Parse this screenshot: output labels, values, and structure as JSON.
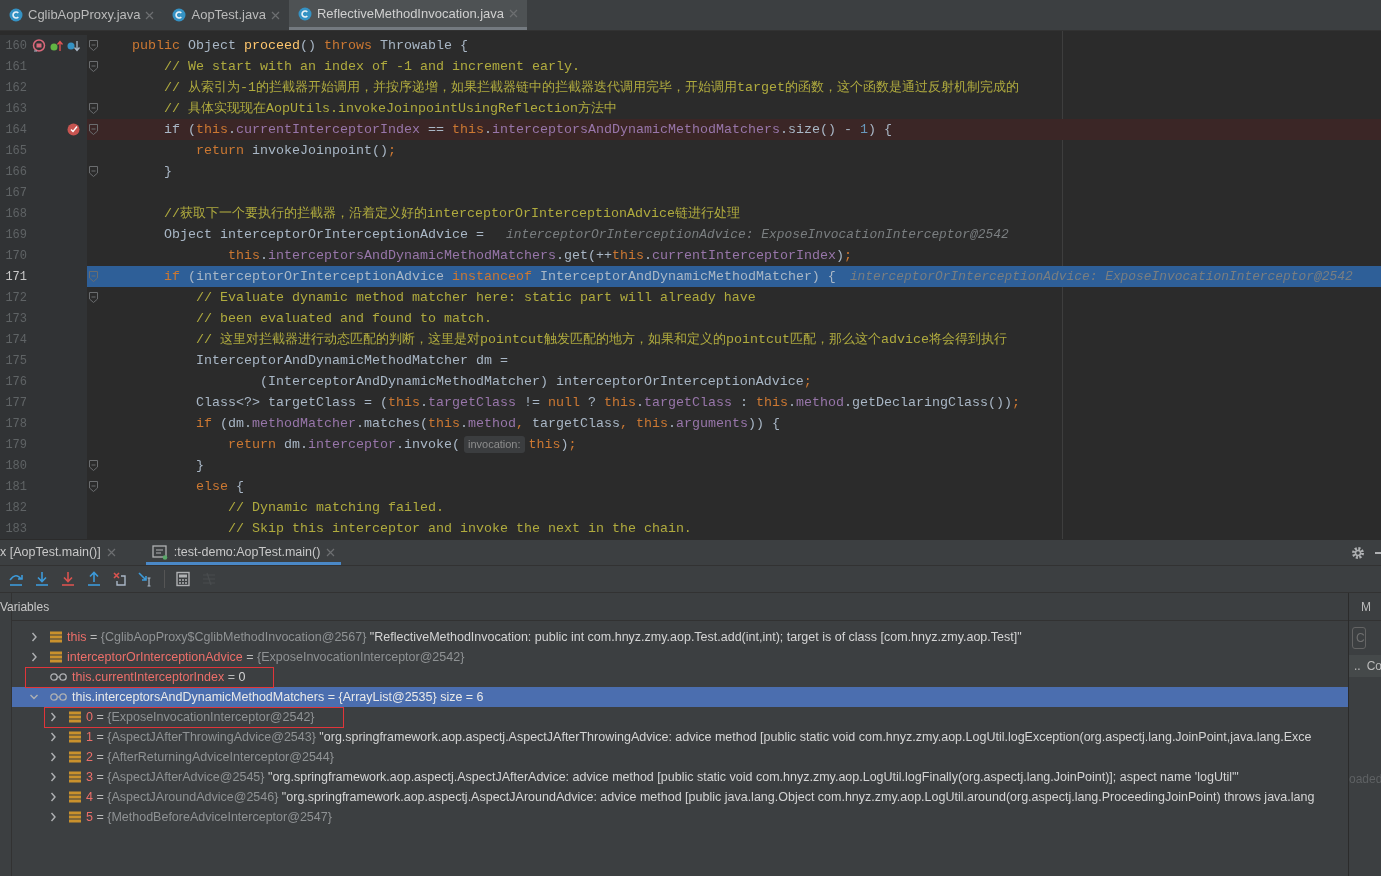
{
  "editor_tabs": [
    {
      "label": "CglibAopProxy.java",
      "selected": false
    },
    {
      "label": "AopTest.java",
      "selected": false
    },
    {
      "label": "ReflectiveMethodInvocation.java",
      "selected": true
    }
  ],
  "code_lines": [
    {
      "number": "160",
      "current": false,
      "fold": true,
      "gutter_icons": [
        {
          "kind": "method_breakpoint"
        },
        {
          "kind": "overrides"
        },
        {
          "kind": "overridden"
        }
      ],
      "tokens": [
        {
          "kind": "keyword",
          "text": "public"
        },
        {
          "kind": "plain",
          "text": " Object "
        },
        {
          "kind": "method",
          "text": "proceed"
        },
        {
          "kind": "plain",
          "text": "() "
        },
        {
          "kind": "keyword",
          "text": "throws"
        },
        {
          "kind": "plain",
          "text": " Throwable {"
        }
      ]
    },
    {
      "number": "161",
      "current": false,
      "fold": true,
      "tokens": [
        {
          "kind": "comment",
          "text": "    // We start with an index of -1 and increment early."
        }
      ]
    },
    {
      "number": "162",
      "current": false,
      "fold": false,
      "tokens": [
        {
          "kind": "comment",
          "text": "    // 从索引为-1的拦截器开始调用，并按序递增，如果拦截器链中的拦截器迭代调用完毕，开始调用target的函数，这个函数是通过反射机制完成的"
        }
      ]
    },
    {
      "number": "163",
      "current": false,
      "fold": true,
      "tokens": [
        {
          "kind": "comment",
          "text": "    // 具体实现现在AopUtils.invokeJoinpointUsingReflection方法中"
        }
      ]
    },
    {
      "number": "164",
      "current": false,
      "fold": true,
      "gutter_icons": [
        {
          "kind": "breakpoint"
        }
      ],
      "tokens": [
        {
          "kind": "plain",
          "text": "    if ("
        },
        {
          "kind": "keyword",
          "text": "this"
        },
        {
          "kind": "plain",
          "text": "."
        },
        {
          "kind": "field",
          "text": "currentInterceptorIndex"
        },
        {
          "kind": "plain",
          "text": " == "
        },
        {
          "kind": "keyword",
          "text": "this"
        },
        {
          "kind": "plain",
          "text": "."
        },
        {
          "kind": "field",
          "text": "interceptorsAndDynamicMethodMatchers"
        },
        {
          "kind": "plain",
          "text": ".size() - "
        },
        {
          "kind": "number",
          "text": "1"
        },
        {
          "kind": "plain",
          "text": ") {"
        }
      ]
    },
    {
      "number": "165",
      "current": false,
      "fold": false,
      "tokens": [
        {
          "kind": "keyword",
          "text": "        return"
        },
        {
          "kind": "plain",
          "text": " invokeJoinpoint()"
        },
        {
          "kind": "keyword",
          "text": ";"
        }
      ]
    },
    {
      "number": "166",
      "current": false,
      "fold": true,
      "tokens": [
        {
          "kind": "plain",
          "text": "    }"
        }
      ]
    },
    {
      "number": "167",
      "current": false,
      "fold": false
    },
    {
      "number": "168",
      "current": false,
      "fold": false,
      "tokens": [
        {
          "kind": "comment",
          "text": "    //获取下一个要执行的拦截器，沿着定义好的interceptorOrInterceptionAdvice链进行处理"
        }
      ]
    },
    {
      "number": "169",
      "current": false,
      "fold": false,
      "tokens": [
        {
          "kind": "plain",
          "text": "    Object interceptorOrInterceptionAdvice = "
        },
        {
          "kind": "hint",
          "text": "interceptorOrInterceptionAdvice: ExposeInvocationInterceptor@2542"
        }
      ]
    },
    {
      "number": "170",
      "current": false,
      "fold": false,
      "tokens": [
        {
          "kind": "keyword",
          "text": "            this"
        },
        {
          "kind": "plain",
          "text": "."
        },
        {
          "kind": "field",
          "text": "interceptorsAndDynamicMethodMatchers"
        },
        {
          "kind": "plain",
          "text": ".get(++"
        },
        {
          "kind": "keyword",
          "text": "this"
        },
        {
          "kind": "plain",
          "text": "."
        },
        {
          "kind": "field",
          "text": "currentInterceptorIndex"
        },
        {
          "kind": "plain",
          "text": ")"
        },
        {
          "kind": "keyword",
          "text": ";"
        }
      ]
    },
    {
      "number": "171",
      "current": true,
      "fold": true,
      "tokens": [
        {
          "kind": "keyword",
          "text": "    if"
        },
        {
          "kind": "plain",
          "text": " (interceptorOrInterceptionAdvice "
        },
        {
          "kind": "keyword",
          "text": "instanceof"
        },
        {
          "kind": "plain",
          "text": " InterceptorAndDynamicMethodMatcher) {"
        },
        {
          "kind": "hint",
          "text": "interceptorOrInterceptionAdvice: ExposeInvocationInterceptor@2542"
        }
      ]
    },
    {
      "number": "172",
      "current": false,
      "fold": true,
      "tokens": [
        {
          "kind": "comment",
          "text": "        // Evaluate dynamic method matcher here: static part will already have"
        }
      ]
    },
    {
      "number": "173",
      "current": false,
      "fold": false,
      "tokens": [
        {
          "kind": "comment",
          "text": "        // been evaluated and found to match."
        }
      ]
    },
    {
      "number": "174",
      "current": false,
      "fold": false,
      "tokens": [
        {
          "kind": "comment",
          "text": "        // 这里对拦截器进行动态匹配的判断，这里是对pointcut触发匹配的地方，如果和定义的pointcut匹配，那么这个advice将会得到执行"
        }
      ]
    },
    {
      "number": "175",
      "current": false,
      "fold": false,
      "tokens": [
        {
          "kind": "plain",
          "text": "        InterceptorAndDynamicMethodMatcher dm ="
        }
      ]
    },
    {
      "number": "176",
      "current": false,
      "fold": false,
      "tokens": [
        {
          "kind": "plain",
          "text": "                (InterceptorAndDynamicMethodMatcher) interceptorOrInterceptionAdvice"
        },
        {
          "kind": "keyword",
          "text": ";"
        }
      ]
    },
    {
      "number": "177",
      "current": false,
      "fold": false,
      "tokens": [
        {
          "kind": "plain",
          "text": "        Class<?> targetClass = ("
        },
        {
          "kind": "keyword",
          "text": "this"
        },
        {
          "kind": "plain",
          "text": "."
        },
        {
          "kind": "field",
          "text": "targetClass"
        },
        {
          "kind": "plain",
          "text": " != "
        },
        {
          "kind": "keyword",
          "text": "null"
        },
        {
          "kind": "plain",
          "text": " ? "
        },
        {
          "kind": "keyword",
          "text": "this"
        },
        {
          "kind": "plain",
          "text": "."
        },
        {
          "kind": "field",
          "text": "targetClass"
        },
        {
          "kind": "plain",
          "text": " : "
        },
        {
          "kind": "keyword",
          "text": "this"
        },
        {
          "kind": "plain",
          "text": "."
        },
        {
          "kind": "field",
          "text": "method"
        },
        {
          "kind": "plain",
          "text": ".getDeclaringClass())"
        },
        {
          "kind": "keyword",
          "text": ";"
        }
      ]
    },
    {
      "number": "178",
      "current": false,
      "fold": false,
      "tokens": [
        {
          "kind": "keyword",
          "text": "        if"
        },
        {
          "kind": "plain",
          "text": " (dm."
        },
        {
          "kind": "field",
          "text": "methodMatcher"
        },
        {
          "kind": "plain",
          "text": ".matches("
        },
        {
          "kind": "keyword",
          "text": "this"
        },
        {
          "kind": "plain",
          "text": "."
        },
        {
          "kind": "field",
          "text": "method"
        },
        {
          "kind": "keyword",
          "text": ","
        },
        {
          "kind": "plain",
          "text": " targetClass"
        },
        {
          "kind": "keyword",
          "text": ", "
        },
        {
          "kind": "keyword",
          "text": "this"
        },
        {
          "kind": "plain",
          "text": "."
        },
        {
          "kind": "field",
          "text": "arguments"
        },
        {
          "kind": "plain",
          "text": ")) {"
        }
      ]
    },
    {
      "number": "179",
      "current": false,
      "fold": false,
      "tokens": [
        {
          "kind": "keyword",
          "text": "            return"
        },
        {
          "kind": "plain",
          "text": " dm."
        },
        {
          "kind": "field",
          "text": "interceptor"
        },
        {
          "kind": "plain",
          "text": ".invoke("
        },
        {
          "kind": "param_hint",
          "text": "invocation:"
        },
        {
          "kind": "keyword",
          "text": "this"
        },
        {
          "kind": "plain",
          "text": ")"
        },
        {
          "kind": "keyword",
          "text": ";"
        }
      ]
    },
    {
      "number": "180",
      "current": false,
      "fold": true,
      "tokens": [
        {
          "kind": "plain",
          "text": "        }"
        }
      ]
    },
    {
      "number": "181",
      "current": false,
      "fold": true,
      "tokens": [
        {
          "kind": "keyword",
          "text": "        else"
        },
        {
          "kind": "plain",
          "text": " {"
        }
      ]
    },
    {
      "number": "182",
      "current": false,
      "fold": false,
      "tokens": [
        {
          "kind": "comment",
          "text": "            // Dynamic matching failed."
        }
      ]
    },
    {
      "number": "183",
      "current": false,
      "fold": false,
      "tokens": [
        {
          "kind": "comment",
          "text": "            // Skip this interceptor and invoke the next in the chain."
        }
      ]
    }
  ],
  "debug_tabs": [
    {
      "label": "x [AopTest.main()]",
      "selected": false
    },
    {
      "label": ":test-demo:AopTest.main()",
      "selected": true
    }
  ],
  "debug_toolbar": [
    {
      "kind": "step_over",
      "disabled": false
    },
    {
      "kind": "step_into",
      "disabled": false
    },
    {
      "kind": "force_step_into",
      "disabled": false
    },
    {
      "kind": "step_out",
      "disabled": false
    },
    {
      "kind": "drop_frame",
      "disabled": false
    },
    {
      "kind": "run_to_cursor",
      "disabled": false
    },
    {
      "kind": "evaluate",
      "disabled": false
    },
    {
      "kind": "trace",
      "disabled": true
    }
  ],
  "variables_title": "Variables",
  "variables": [
    {
      "kind": "field",
      "name": "this",
      "separator": "=",
      "object": "{CglibAopProxy$CglibMethodInvocation@2567}",
      "detail": "\"ReflectiveMethodInvocation: public int com.hnyz.zmy.aop.Test.add(int,int); target is of class [com.hnyz.zmy.aop.Test]\"",
      "leaf": false,
      "expanded": false,
      "selected": false,
      "marked": false
    },
    {
      "kind": "field",
      "name": "interceptorOrInterceptionAdvice",
      "separator": "=",
      "object": "{ExposeInvocationInterceptor@2542}",
      "leaf": false,
      "expanded": false,
      "selected": false,
      "marked": false
    },
    {
      "kind": "watch",
      "name": "this.currentInterceptorIndex",
      "separator": "=",
      "value": "0",
      "leaf": true,
      "expanded": false,
      "selected": false,
      "marked": true
    },
    {
      "kind": "watch",
      "name": "this.interceptorsAndDynamicMethodMatchers",
      "separator": "=",
      "object": "{ArrayList@2535}",
      "detail": "size = 6",
      "leaf": false,
      "expanded": true,
      "selected": true,
      "marked": false,
      "children": [
        {
          "kind": "field",
          "name": "0",
          "separator": "=",
          "object": "{ExposeInvocationInterceptor@2542}",
          "leaf": false,
          "expanded": false,
          "selected": false,
          "marked": true
        },
        {
          "kind": "field",
          "name": "1",
          "separator": "=",
          "object": "{AspectJAfterThrowingAdvice@2543}",
          "detail": "\"org.springframework.aop.aspectj.AspectJAfterThrowingAdvice: advice method [public static void com.hnyz.zmy.aop.LogUtil.logException(org.aspectj.lang.JoinPoint,java.lang.Exce",
          "leaf": false,
          "expanded": false,
          "selected": false,
          "marked": false
        },
        {
          "kind": "field",
          "name": "2",
          "separator": "=",
          "object": "{AfterReturningAdviceInterceptor@2544}",
          "leaf": false,
          "expanded": false,
          "selected": false,
          "marked": false
        },
        {
          "kind": "field",
          "name": "3",
          "separator": "=",
          "object": "{AspectJAfterAdvice@2545}",
          "detail": "\"org.springframework.aop.aspectj.AspectJAfterAdvice: advice method [public static void com.hnyz.zmy.aop.LogUtil.logFinally(org.aspectj.lang.JoinPoint)]; aspect name 'logUtil'\"",
          "leaf": false,
          "expanded": false,
          "selected": false,
          "marked": false
        },
        {
          "kind": "field",
          "name": "4",
          "separator": "=",
          "object": "{AspectJAroundAdvice@2546}",
          "detail": "\"org.springframework.aop.aspectj.AspectJAroundAdvice: advice method [public java.lang.Object com.hnyz.zmy.aop.LogUtil.around(org.aspectj.lang.ProceedingJoinPoint) throws java.lang",
          "leaf": false,
          "expanded": false,
          "selected": false,
          "marked": false
        },
        {
          "kind": "field",
          "name": "5",
          "separator": "=",
          "object": "{MethodBeforeAdviceInterceptor@2547}",
          "leaf": false,
          "expanded": false,
          "selected": false,
          "marked": false
        }
      ]
    }
  ],
  "side_panel": {
    "title": "M",
    "field_value": "C",
    "button": "..",
    "column": "Co",
    "message": "oaded"
  }
}
